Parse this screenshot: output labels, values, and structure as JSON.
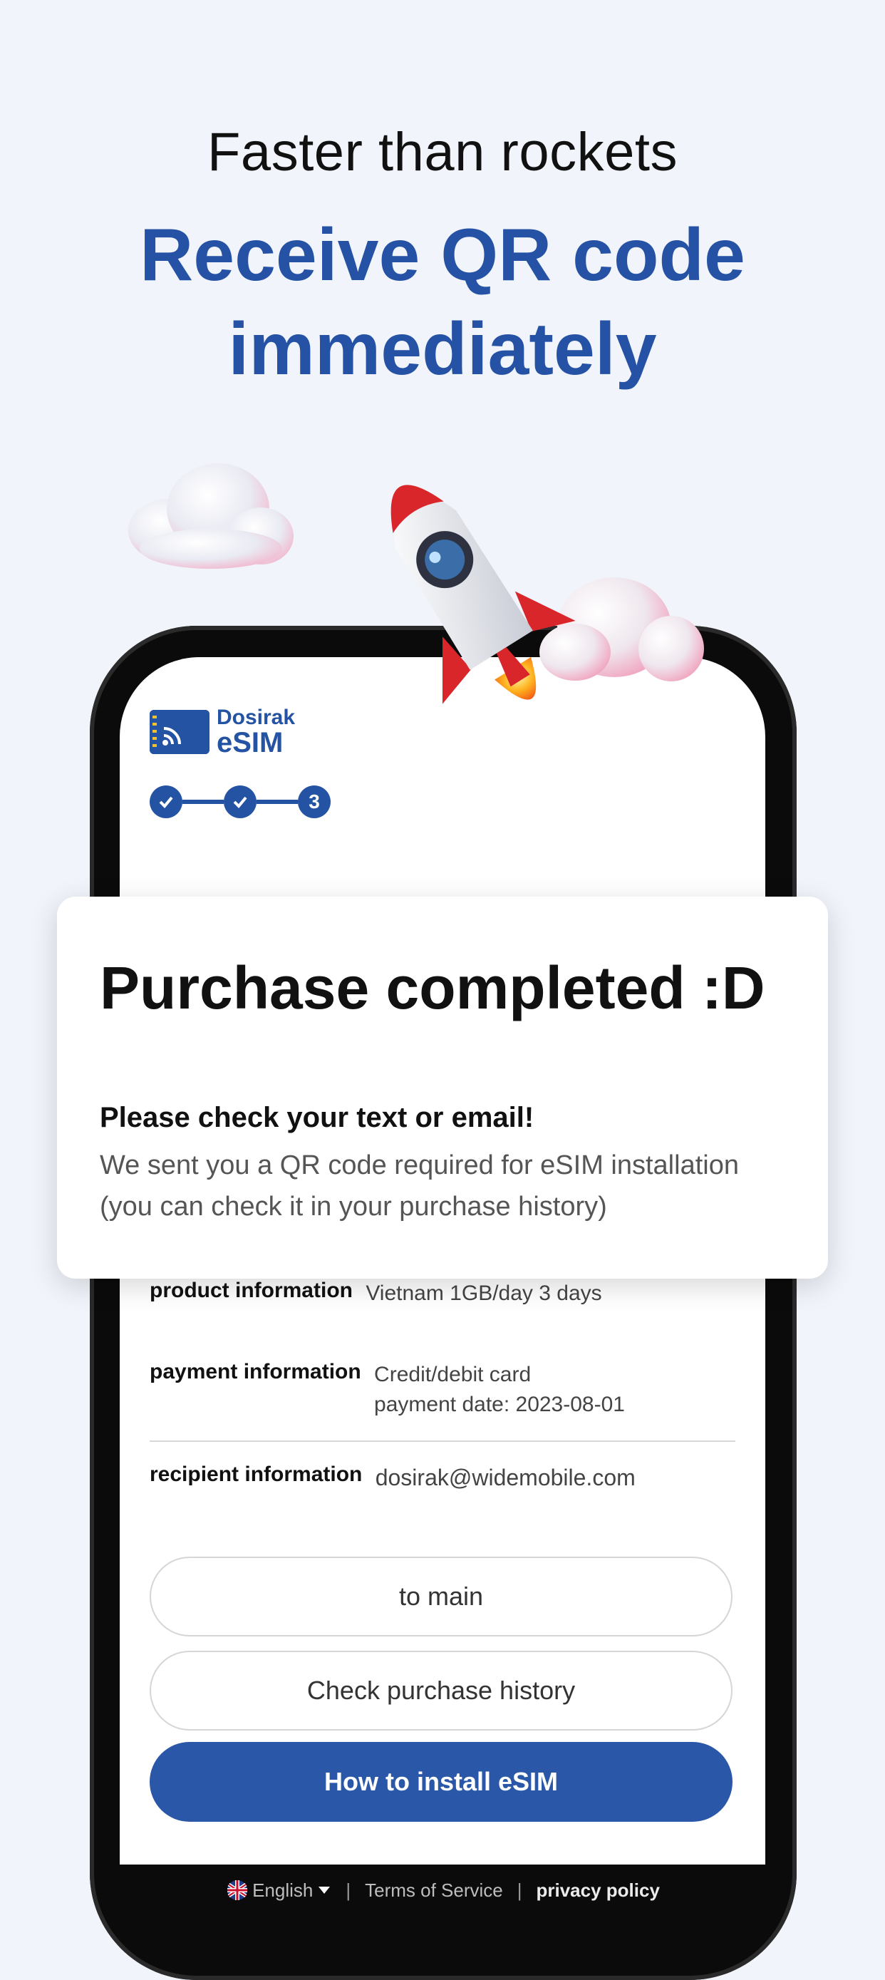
{
  "header": {
    "tagline": "Faster than rockets",
    "headline_line1": "Receive QR code",
    "headline_line2": "immediately"
  },
  "app": {
    "brand_top": "Dosirak",
    "brand_bottom": "eSIM",
    "steps": [
      {
        "state": "done",
        "label": ""
      },
      {
        "state": "done",
        "label": ""
      },
      {
        "state": "current",
        "label": "3"
      }
    ],
    "product": {
      "label": "product information",
      "value": "Vietnam 1GB/day 3 days"
    },
    "payment": {
      "label": "payment information",
      "method": "Credit/debit card",
      "date": "payment date: 2023-08-01"
    },
    "recipient": {
      "label": "recipient information",
      "value": "dosirak@widemobile.com"
    },
    "buttons": {
      "to_main": "to main",
      "history": "Check purchase history",
      "install": "How to install eSIM"
    },
    "footer": {
      "language": "English",
      "terms": "Terms of Service",
      "privacy": "privacy policy",
      "separator": "|"
    }
  },
  "card": {
    "title": "Purchase completed :D",
    "subtitle": "Please check your text or email!",
    "line1": "We sent you a QR code required for eSIM installation",
    "line2": "(you can check it in your purchase history)"
  },
  "colors": {
    "accent": "#2652a6",
    "background": "#f1f5fb"
  }
}
